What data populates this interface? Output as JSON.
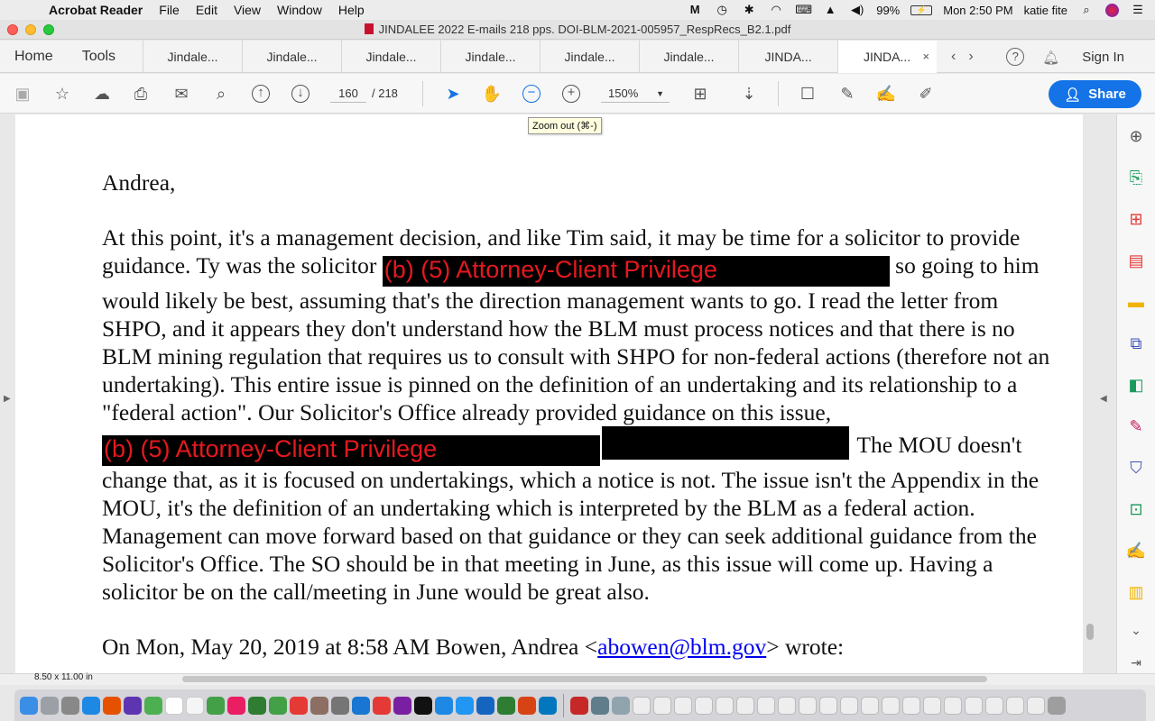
{
  "menubar": {
    "app_name": "Acrobat Reader",
    "items": [
      "File",
      "Edit",
      "View",
      "Window",
      "Help"
    ],
    "battery": "99%",
    "clock": "Mon 2:50 PM",
    "user": "katie fite"
  },
  "window": {
    "title": "JINDALEE  2022 E-mails 218 pps. DOI-BLM-2021-005957_RespRecs_B2.1.pdf"
  },
  "tabs": {
    "home": "Home",
    "tools": "Tools",
    "documents": [
      "Jindale...",
      "Jindale...",
      "Jindale...",
      "Jindale...",
      "Jindale...",
      "Jindale...",
      "JINDA...",
      "JINDA..."
    ],
    "close": "×",
    "help": "?",
    "sign_in": "Sign In"
  },
  "toolbar": {
    "current_page": "160",
    "page_total": "/ 218",
    "zoom": "150%",
    "share_label": "Share",
    "tooltip": "Zoom out (⌘-)"
  },
  "document": {
    "greeting": "Andrea,",
    "p1_a": "At this point, it's a management decision, and like Tim said, it may be time for a solicitor to provide guidance. Ty was the solicitor ",
    "redaction_1": "(b) (5) Attorney-Client Privilege",
    "p1_b": " so going to him would likely be best, assuming that's the direction management wants to go. I read the letter from SHPO, and it appears they don't understand how the BLM must process notices and that there is no BLM mining regulation that requires us to consult with SHPO for non-federal actions (therefore not an undertaking). This entire issue is pinned on the definition of an undertaking and its relationship to a \"federal action\". Our Solicitor's Office already provided guidance on this issue, ",
    "redaction_2": "(b) (5) Attorney-Client Privilege",
    "p1_c": "The MOU doesn't change that, as it is focused on undertakings, which a notice is not. The issue isn't the Appendix in the MOU, it's the definition of an undertaking which is interpreted by the BLM as a federal action. Management can move forward based on that guidance or they can seek additional guidance from the Solicitor's Office. The SO should be in that meeting in June, as this issue will come up. Having a solicitor be on the call/meeting in June would be great also.",
    "reply_prefix": "On Mon, May 20, 2019 at 8:58 AM Bowen, Andrea <",
    "reply_email": "abowen@blm.gov",
    "reply_suffix": "> wrote:"
  },
  "status": {
    "page_size": "8.50 x 11.00 in"
  },
  "colors": {
    "accent": "#1473e6",
    "redaction_text": "#e4191f"
  }
}
